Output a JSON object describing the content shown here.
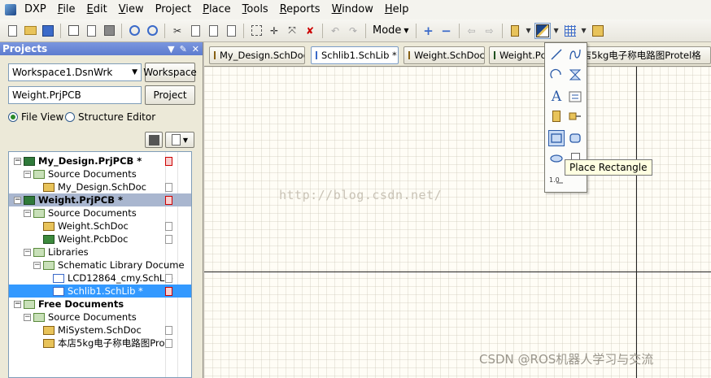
{
  "app": {
    "name": "DXP"
  },
  "menu": {
    "items": [
      {
        "key": "file",
        "mnemonic": "F",
        "rest": "ile"
      },
      {
        "key": "edit",
        "mnemonic": "E",
        "rest": "dit"
      },
      {
        "key": "view",
        "mnemonic": "V",
        "rest": "iew"
      },
      {
        "key": "project",
        "mnemonic": "P",
        "rest": "roject",
        "prefix": ""
      },
      {
        "key": "place",
        "mnemonic": "P",
        "rest": "lace"
      },
      {
        "key": "tools",
        "mnemonic": "T",
        "rest": "ools"
      },
      {
        "key": "reports",
        "mnemonic": "R",
        "rest": "eports"
      },
      {
        "key": "window",
        "mnemonic": "W",
        "rest": "indow"
      },
      {
        "key": "help",
        "mnemonic": "H",
        "rest": "elp"
      }
    ]
  },
  "toolbar": {
    "mode_label": "Mode"
  },
  "panel": {
    "title": "Projects",
    "workspace_value": "Workspace1.DsnWrk",
    "workspace_button": "Workspace",
    "project_value": "Weight.PrjPCB",
    "project_button": "Project",
    "view_file": "File View",
    "view_structure": "Structure Editor"
  },
  "tree": [
    {
      "label": "My_Design.PrjPCB *",
      "level": 0,
      "kind": "proj",
      "expand": "−",
      "bold": true,
      "flag": "red"
    },
    {
      "label": "Source Documents",
      "level": 1,
      "kind": "fold",
      "expand": "−"
    },
    {
      "label": "My_Design.SchDoc",
      "level": 2,
      "kind": "sch",
      "flag": "grey"
    },
    {
      "label": "Weight.PrjPCB *",
      "level": 0,
      "kind": "proj",
      "expand": "−",
      "bold": true,
      "flag": "red",
      "state": "grey"
    },
    {
      "label": "Source Documents",
      "level": 1,
      "kind": "fold",
      "expand": "−"
    },
    {
      "label": "Weight.SchDoc",
      "level": 2,
      "kind": "sch",
      "flag": "grey"
    },
    {
      "label": "Weight.PcbDoc",
      "level": 2,
      "kind": "pcb",
      "flag": "grey"
    },
    {
      "label": "Libraries",
      "level": 1,
      "kind": "fold",
      "expand": "−"
    },
    {
      "label": "Schematic Library Docume",
      "level": 2,
      "kind": "fold",
      "expand": "−",
      "flag": "none"
    },
    {
      "label": "LCD12864_cmy.SchLib",
      "level": 3,
      "kind": "lib",
      "flag": "grey"
    },
    {
      "label": "Schlib1.SchLib *",
      "level": 3,
      "kind": "lib",
      "flag": "red",
      "state": "blue"
    },
    {
      "label": "Free Documents",
      "level": 0,
      "kind": "fold",
      "expand": "−",
      "bold": true
    },
    {
      "label": "Source Documents",
      "level": 1,
      "kind": "fold",
      "expand": "−"
    },
    {
      "label": "MiSystem.SchDoc",
      "level": 2,
      "kind": "sch",
      "flag": "grey"
    },
    {
      "label": "本店5kg电子称电路图Pro",
      "level": 2,
      "kind": "sch",
      "flag": "grey"
    }
  ],
  "tabs": [
    {
      "label": "My_Design.SchDoc",
      "kind": "sch"
    },
    {
      "label": "Schlib1.SchLib *",
      "kind": "lib",
      "active": true
    },
    {
      "label": "Weight.SchDoc",
      "kind": "sch"
    },
    {
      "label": "Weight.Pc",
      "kind": "pcb"
    },
    {
      "label": "本店5kg电子称电路图Protel格",
      "kind": "sch"
    }
  ],
  "canvas": {
    "watermark_blog": "http://blog.csdn.net/",
    "watermark_csdn": "CSDN @ROS机器人学习与交流"
  },
  "palette": {
    "tooltip": "Place Rectangle",
    "hovered": "place-rectangle"
  },
  "colors": {
    "accent": "#3399ff",
    "panel_header": "#5d7ccf",
    "canvas_bg": "#fffdf6"
  }
}
